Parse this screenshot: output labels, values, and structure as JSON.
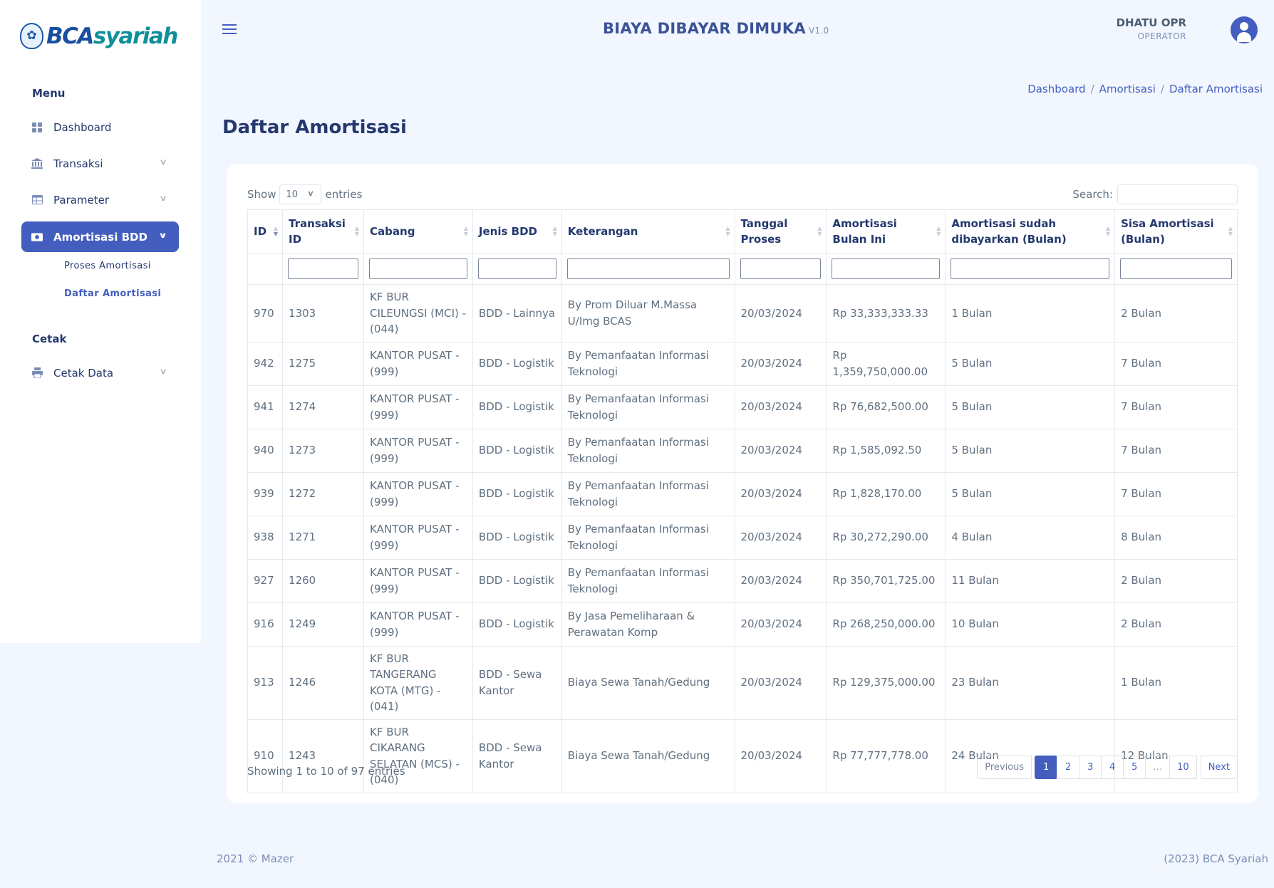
{
  "brand": {
    "logo_primary": "BCA",
    "logo_secondary": "syariah",
    "emblem": "shield-emblem"
  },
  "header": {
    "title": "BIAYA DIBAYAR DIMUKA",
    "version": "V1.0"
  },
  "user": {
    "name": "DHATU OPR",
    "role": "OPERATOR"
  },
  "sidebar": {
    "menu_title": "Menu",
    "print_title": "Cetak",
    "items": [
      {
        "label": "Dashboard",
        "icon": "grid-icon"
      },
      {
        "label": "Transaksi",
        "icon": "bank-icon"
      },
      {
        "label": "Parameter",
        "icon": "table-icon"
      },
      {
        "label": "Amortisasi BDD",
        "icon": "cash-icon"
      },
      {
        "label": "Cetak Data",
        "icon": "printer-icon"
      }
    ],
    "sub_items": [
      {
        "label": "Proses Amortisasi"
      },
      {
        "label": "Daftar Amortisasi"
      }
    ]
  },
  "breadcrumb": [
    "Dashboard",
    "Amortisasi",
    "Daftar Amortisasi"
  ],
  "breadcrumb_sep": "/",
  "page_title": "Daftar Amortisasi",
  "table_controls": {
    "show_label": "Show",
    "page_size": "10",
    "entries_label": "entries",
    "search_label": "Search:"
  },
  "table": {
    "columns": [
      "ID",
      "Transaksi ID",
      "Cabang",
      "Jenis BDD",
      "Keterangan",
      "Tanggal Proses",
      "Amortisasi Bulan Ini",
      "Amortisasi sudah dibayarkan (Bulan)",
      "Sisa Amortisasi (Bulan)"
    ],
    "rows": [
      [
        "970",
        "1303",
        "KF BUR CILEUNGSI (MCI) - (044)",
        "BDD - Lainnya",
        "By Prom Diluar M.Massa U/Img BCAS",
        "20/03/2024",
        "Rp 33,333,333.33",
        "1 Bulan",
        "2 Bulan"
      ],
      [
        "942",
        "1275",
        "KANTOR PUSAT - (999)",
        "BDD - Logistik",
        "By Pemanfaatan Informasi Teknologi",
        "20/03/2024",
        "Rp 1,359,750,000.00",
        "5 Bulan",
        "7 Bulan"
      ],
      [
        "941",
        "1274",
        "KANTOR PUSAT - (999)",
        "BDD - Logistik",
        "By Pemanfaatan Informasi Teknologi",
        "20/03/2024",
        "Rp 76,682,500.00",
        "5 Bulan",
        "7 Bulan"
      ],
      [
        "940",
        "1273",
        "KANTOR PUSAT - (999)",
        "BDD - Logistik",
        "By Pemanfaatan Informasi Teknologi",
        "20/03/2024",
        "Rp 1,585,092.50",
        "5 Bulan",
        "7 Bulan"
      ],
      [
        "939",
        "1272",
        "KANTOR PUSAT - (999)",
        "BDD - Logistik",
        "By Pemanfaatan Informasi Teknologi",
        "20/03/2024",
        "Rp 1,828,170.00",
        "5 Bulan",
        "7 Bulan"
      ],
      [
        "938",
        "1271",
        "KANTOR PUSAT - (999)",
        "BDD - Logistik",
        "By Pemanfaatan Informasi Teknologi",
        "20/03/2024",
        "Rp 30,272,290.00",
        "4 Bulan",
        "8 Bulan"
      ],
      [
        "927",
        "1260",
        "KANTOR PUSAT - (999)",
        "BDD - Logistik",
        "By Pemanfaatan Informasi Teknologi",
        "20/03/2024",
        "Rp 350,701,725.00",
        "11 Bulan",
        "2 Bulan"
      ],
      [
        "916",
        "1249",
        "KANTOR PUSAT - (999)",
        "BDD - Logistik",
        "By Jasa Pemeliharaan & Perawatan Komp",
        "20/03/2024",
        "Rp 268,250,000.00",
        "10 Bulan",
        "2 Bulan"
      ],
      [
        "913",
        "1246",
        "KF BUR TANGERANG KOTA (MTG) - (041)",
        "BDD - Sewa Kantor",
        "Biaya Sewa Tanah/Gedung",
        "20/03/2024",
        "Rp 129,375,000.00",
        "23 Bulan",
        "1 Bulan"
      ],
      [
        "910",
        "1243",
        "KF BUR CIKARANG SELATAN (MCS) - (040)",
        "BDD - Sewa Kantor",
        "Biaya Sewa Tanah/Gedung",
        "20/03/2024",
        "Rp 77,777,778.00",
        "24 Bulan",
        "12 Bulan"
      ]
    ]
  },
  "table_info": "Showing 1 to 10 of 97 entries",
  "pagination": {
    "previous": "Previous",
    "next": "Next",
    "pages": [
      "1",
      "2",
      "3",
      "4",
      "5",
      "…",
      "10"
    ],
    "current": "1"
  },
  "footer": {
    "left": "2021 © Mazer",
    "right": "(2023) BCA Syariah"
  },
  "colors": {
    "primary": "#435ebe",
    "background": "#f2f7ff",
    "heading": "#25396f"
  }
}
